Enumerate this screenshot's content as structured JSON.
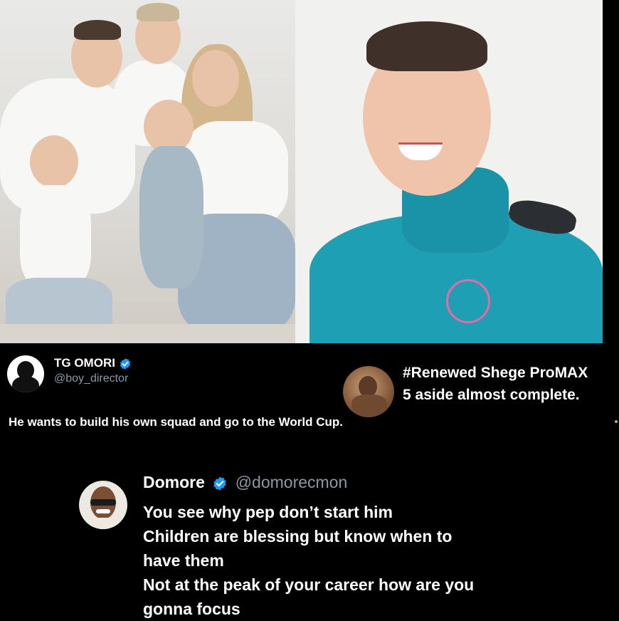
{
  "tweet_tg": {
    "name": "TG OMORI",
    "handle": "@boy_director",
    "text": "He wants to build his own squad and go to the World Cup."
  },
  "tweet_shege": {
    "name": "#Renewed Shege ProMAX",
    "text": "5 aside almost complete."
  },
  "tweet_domore": {
    "name": "Domore",
    "handle": "@domorecmon",
    "lines": [
      "You see why pep don’t start him",
      "Children are blessing but know when to",
      "have them",
      "Not at the peak of your career how are you",
      "gonna focus"
    ]
  },
  "colors": {
    "background": "#000000",
    "text": "#ffffff",
    "handle": "#8b98a5",
    "verified": "#1d9bf0",
    "jacket": "#1f9fb4"
  },
  "icons": [
    "verified-badge-icon",
    "avatar-icon"
  ]
}
